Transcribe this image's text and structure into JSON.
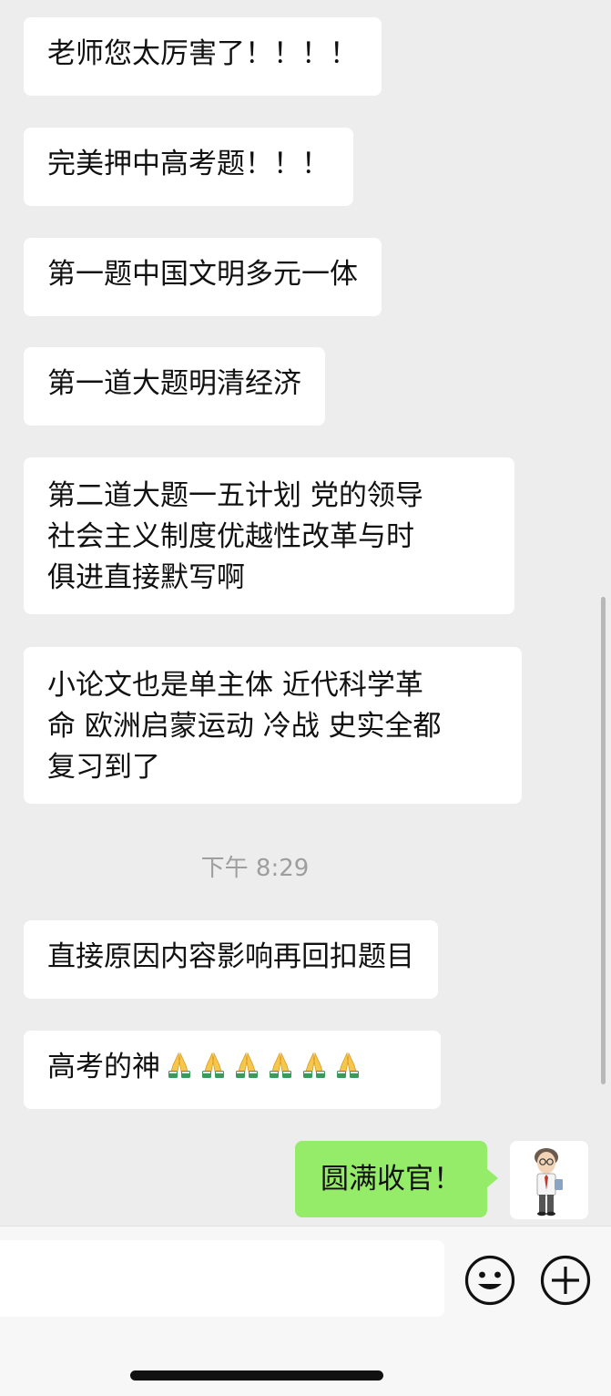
{
  "messages": [
    {
      "text": "老师您太厉害了！！！！"
    },
    {
      "text": "完美押中高考题！！！"
    },
    {
      "text": "第一题中国文明多元一体"
    },
    {
      "text": "第一道大题明清经济"
    },
    {
      "lines": [
        "第二道大题一五计划  党的领导",
        "社会主义制度优越性改革与时",
        "俱进直接默写啊"
      ]
    },
    {
      "lines": [
        "小论文也是单主体 近代科学革",
        "命 欧洲启蒙运动 冷战 史实全都",
        "复习到了"
      ]
    },
    {
      "text": "直接原因内容影响再回扣题目"
    },
    {
      "text": "高考的神",
      "emoji_count": 6,
      "emoji": "folded-hands"
    }
  ],
  "timestamp": "下午 8:29",
  "sent_message": {
    "text": "圆满收官！"
  },
  "colors": {
    "background": "#ededed",
    "received_bubble": "#ffffff",
    "sent_bubble": "#95ec69"
  },
  "icons": {
    "emoji_button": "smiley-icon",
    "more_button": "plus-circle-icon"
  }
}
